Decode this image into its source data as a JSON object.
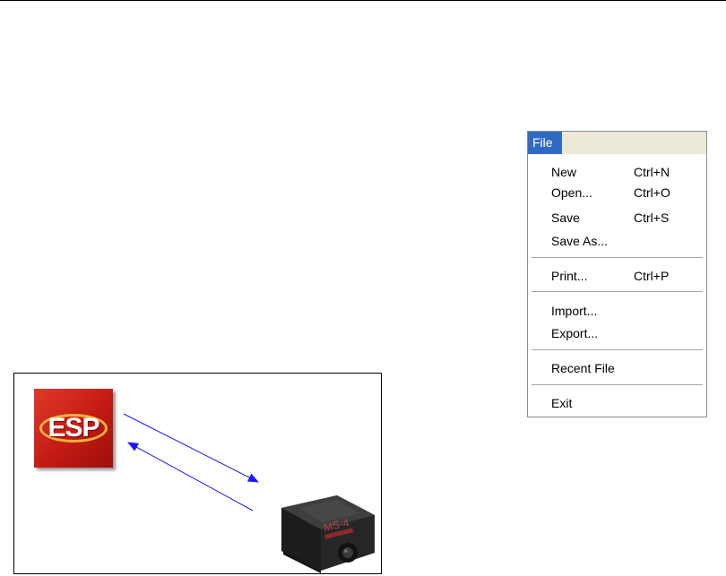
{
  "menu": {
    "title": "File",
    "items": [
      {
        "label": "New",
        "shortcut": "Ctrl+N"
      },
      {
        "label": "Open...",
        "shortcut": "Ctrl+O"
      },
      {
        "label": "Save",
        "shortcut": "Ctrl+S"
      },
      {
        "label": "Save As...",
        "shortcut": ""
      },
      {
        "label": "Print...",
        "shortcut": "Ctrl+P"
      },
      {
        "label": "Import...",
        "shortcut": ""
      },
      {
        "label": "Export...",
        "shortcut": ""
      },
      {
        "label": "Recent File",
        "shortcut": ""
      },
      {
        "label": "Exit",
        "shortcut": ""
      }
    ]
  },
  "diagram": {
    "logo_text": "ESP",
    "device_label": "MS-4",
    "arrow_color": "#1a1aff",
    "logo_color": "#c31b14"
  }
}
